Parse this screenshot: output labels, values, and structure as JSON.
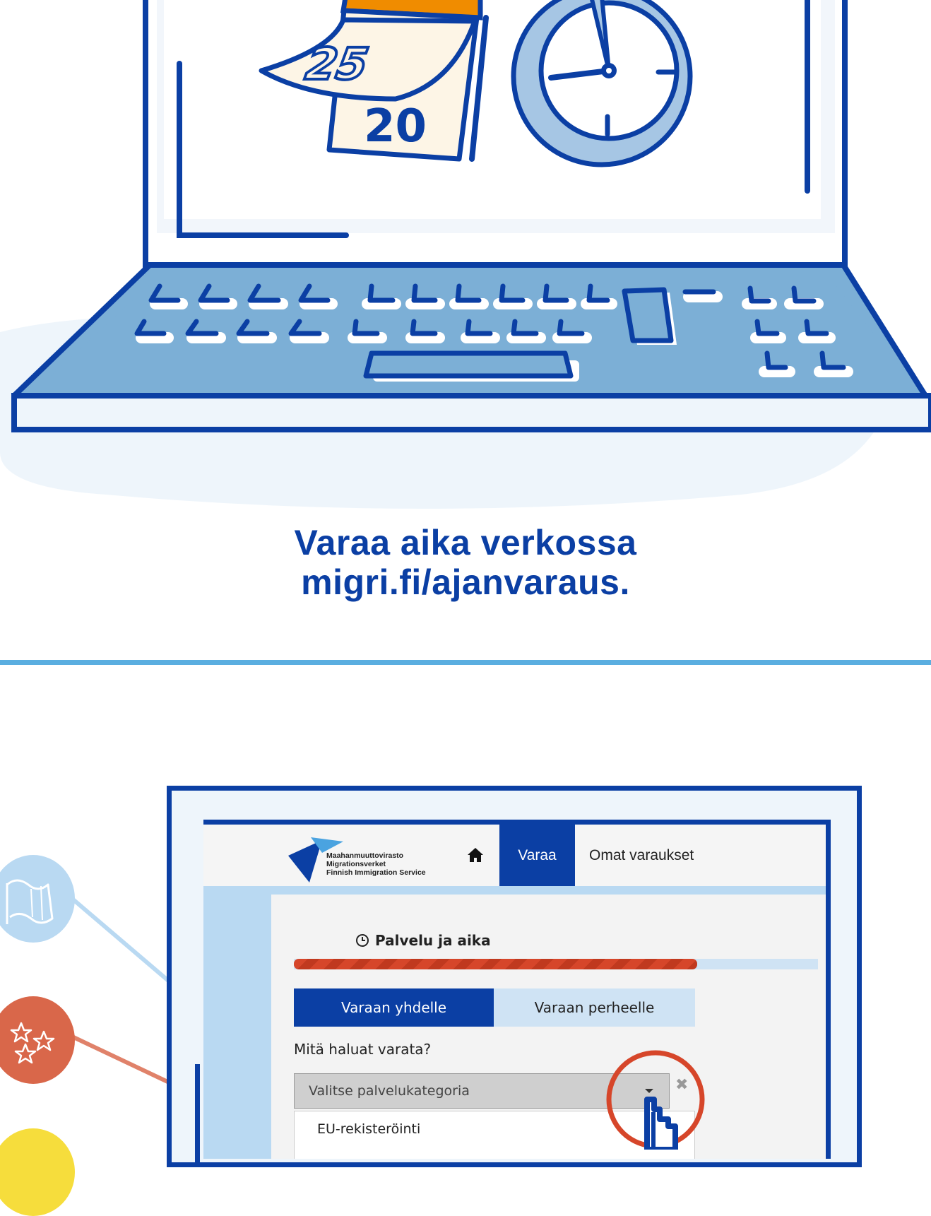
{
  "headline": {
    "line1": "Varaa aika verkossa",
    "line2": "migri.fi/ajanvaraus."
  },
  "calendar": {
    "top_page": "25",
    "back_page": "20"
  },
  "mockup": {
    "logo": {
      "line1": "Maahanmuuttovirasto",
      "line2": "Migrationsverket",
      "line3": "Finnish Immigration Service"
    },
    "nav": {
      "home_icon": "home-icon",
      "tab_book": "Varaa",
      "tab_my": "Omat varaukset"
    },
    "step_title": "Palvelu ja aika",
    "progress_fraction": 0.77,
    "segments": {
      "one": "Varaan yhdelle",
      "family": "Varaan perheelle"
    },
    "question": "Mitä haluat varata?",
    "select_placeholder": "Valitse palvelukategoria",
    "clear_icon": "✖",
    "dropdown_items": [
      "EU-rekisteröinti"
    ]
  },
  "colors": {
    "primary": "#0b3fa4",
    "light_blue": "#b9d9f2",
    "accent_orange": "#f08c00",
    "highlight_red": "#d6462a",
    "yellow": "#f6dd3c"
  }
}
